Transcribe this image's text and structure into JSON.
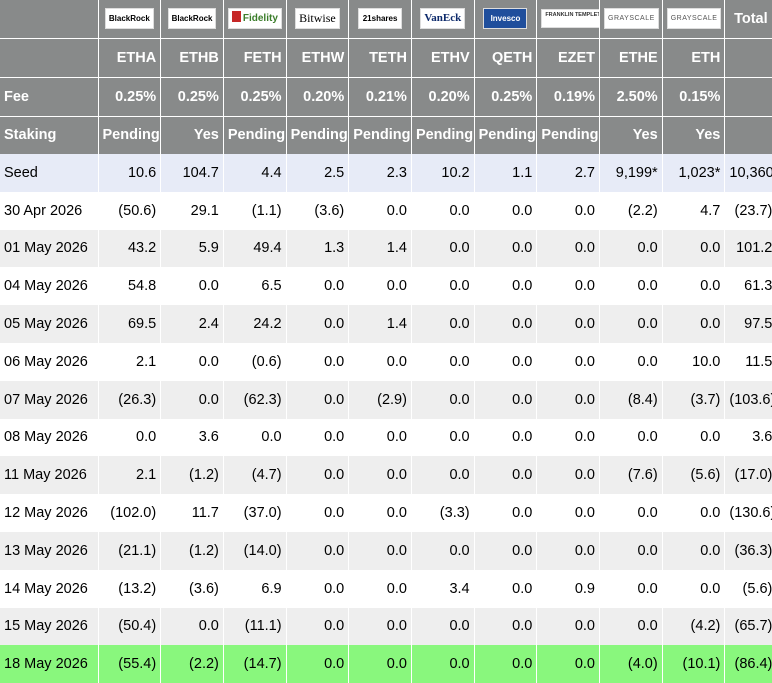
{
  "issuers": [
    {
      "logo": "BlackRock",
      "ticker": "ETHA",
      "fee": "0.25%",
      "staking": "Pending"
    },
    {
      "logo": "BlackRock",
      "ticker": "ETHB",
      "fee": "0.25%",
      "staking": "Yes"
    },
    {
      "logo": "Fidelity",
      "ticker": "FETH",
      "fee": "0.25%",
      "staking": "Pending"
    },
    {
      "logo": "Bitwise",
      "ticker": "ETHW",
      "fee": "0.20%",
      "staking": "Pending"
    },
    {
      "logo": "21shares",
      "ticker": "TETH",
      "fee": "0.21%",
      "staking": "Pending"
    },
    {
      "logo": "VanEck",
      "ticker": "ETHV",
      "fee": "0.20%",
      "staking": "Pending"
    },
    {
      "logo": "Invesco",
      "ticker": "QETH",
      "fee": "0.25%",
      "staking": "Pending"
    },
    {
      "logo": "FRANKLIN TEMPLETON",
      "ticker": "EZET",
      "fee": "0.19%",
      "staking": "Pending"
    },
    {
      "logo": "GRAYSCALE",
      "ticker": "ETHE",
      "fee": "2.50%",
      "staking": "Yes"
    },
    {
      "logo": "GRAYSCALE",
      "ticker": "ETH",
      "fee": "0.15%",
      "staking": "Yes"
    }
  ],
  "labels": {
    "fee": "Fee",
    "staking": "Staking",
    "total": "Total"
  },
  "rows": [
    {
      "date": "Seed",
      "values": [
        "10.6",
        "104.7",
        "4.4",
        "2.5",
        "2.3",
        "10.2",
        "1.1",
        "2.7",
        "9,199*",
        "1,023*"
      ],
      "total": "10,360"
    },
    {
      "date": "30 Apr 2026",
      "values": [
        "(50.6)",
        "29.1",
        "(1.1)",
        "(3.6)",
        "0.0",
        "0.0",
        "0.0",
        "0.0",
        "(2.2)",
        "4.7"
      ],
      "total": "(23.7)"
    },
    {
      "date": "01 May 2026",
      "values": [
        "43.2",
        "5.9",
        "49.4",
        "1.3",
        "1.4",
        "0.0",
        "0.0",
        "0.0",
        "0.0",
        "0.0"
      ],
      "total": "101.2"
    },
    {
      "date": "04 May 2026",
      "values": [
        "54.8",
        "0.0",
        "6.5",
        "0.0",
        "0.0",
        "0.0",
        "0.0",
        "0.0",
        "0.0",
        "0.0"
      ],
      "total": "61.3"
    },
    {
      "date": "05 May 2026",
      "values": [
        "69.5",
        "2.4",
        "24.2",
        "0.0",
        "1.4",
        "0.0",
        "0.0",
        "0.0",
        "0.0",
        "0.0"
      ],
      "total": "97.5"
    },
    {
      "date": "06 May 2026",
      "values": [
        "2.1",
        "0.0",
        "(0.6)",
        "0.0",
        "0.0",
        "0.0",
        "0.0",
        "0.0",
        "0.0",
        "10.0"
      ],
      "total": "11.5"
    },
    {
      "date": "07 May 2026",
      "values": [
        "(26.3)",
        "0.0",
        "(62.3)",
        "0.0",
        "(2.9)",
        "0.0",
        "0.0",
        "0.0",
        "(8.4)",
        "(3.7)"
      ],
      "total": "(103.6)"
    },
    {
      "date": "08 May 2026",
      "values": [
        "0.0",
        "3.6",
        "0.0",
        "0.0",
        "0.0",
        "0.0",
        "0.0",
        "0.0",
        "0.0",
        "0.0"
      ],
      "total": "3.6"
    },
    {
      "date": "11 May 2026",
      "values": [
        "2.1",
        "(1.2)",
        "(4.7)",
        "0.0",
        "0.0",
        "0.0",
        "0.0",
        "0.0",
        "(7.6)",
        "(5.6)"
      ],
      "total": "(17.0)"
    },
    {
      "date": "12 May 2026",
      "values": [
        "(102.0)",
        "11.7",
        "(37.0)",
        "0.0",
        "0.0",
        "(3.3)",
        "0.0",
        "0.0",
        "0.0",
        "0.0"
      ],
      "total": "(130.6)"
    },
    {
      "date": "13 May 2026",
      "values": [
        "(21.1)",
        "(1.2)",
        "(14.0)",
        "0.0",
        "0.0",
        "0.0",
        "0.0",
        "0.0",
        "0.0",
        "0.0"
      ],
      "total": "(36.3)"
    },
    {
      "date": "14 May 2026",
      "values": [
        "(13.2)",
        "(3.6)",
        "6.9",
        "0.0",
        "0.0",
        "3.4",
        "0.0",
        "0.9",
        "0.0",
        "0.0"
      ],
      "total": "(5.6)"
    },
    {
      "date": "15 May 2026",
      "values": [
        "(50.4)",
        "0.0",
        "(11.1)",
        "0.0",
        "0.0",
        "0.0",
        "0.0",
        "0.0",
        "0.0",
        "(4.2)"
      ],
      "total": "(65.7)"
    },
    {
      "date": "18 May 2026",
      "values": [
        "(55.4)",
        "(2.2)",
        "(14.7)",
        "0.0",
        "0.0",
        "0.0",
        "0.0",
        "0.0",
        "(4.0)",
        "(10.1)"
      ],
      "total": "(86.4)"
    }
  ]
}
